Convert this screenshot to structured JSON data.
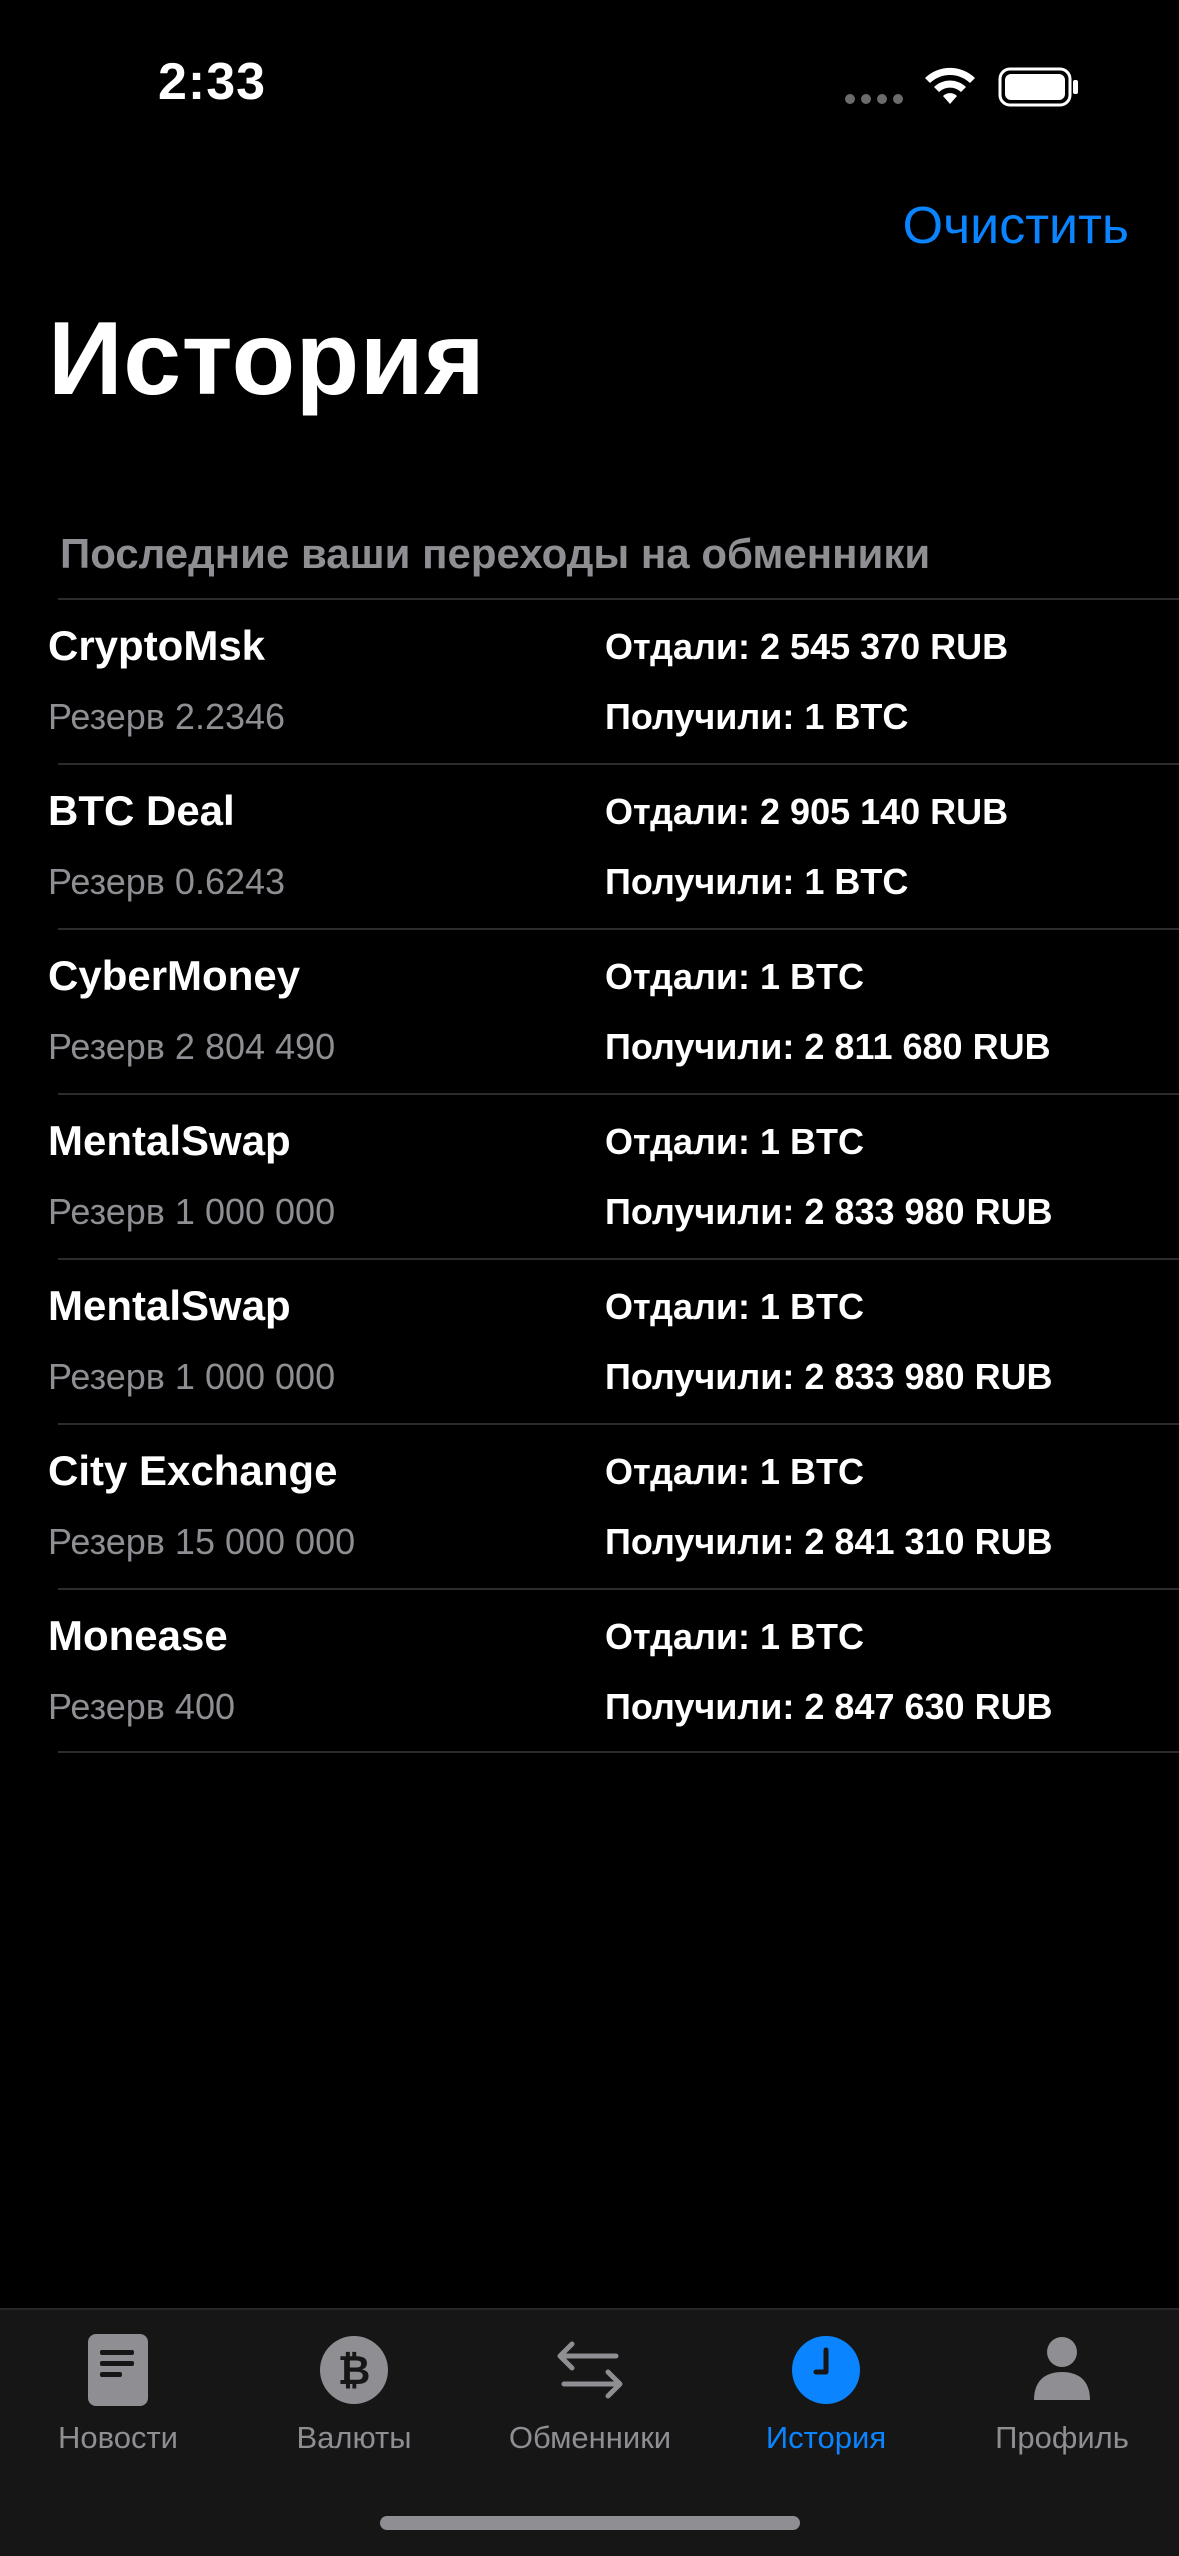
{
  "status_bar": {
    "time": "2:33"
  },
  "nav": {
    "clear_label": "Очистить",
    "title": "История"
  },
  "section": {
    "header": "Последние ваши переходы на обменники"
  },
  "history": [
    {
      "name": "CryptoMsk",
      "reserve": "Резерв 2.2346",
      "gave": "Отдали: 2 545 370 RUB",
      "received": "Получили: 1 BTC"
    },
    {
      "name": "BTC Deal",
      "reserve": "Резерв 0.6243",
      "gave": "Отдали: 2 905 140 RUB",
      "received": "Получили: 1 BTC"
    },
    {
      "name": "CyberMoney",
      "reserve": "Резерв 2 804 490",
      "gave": "Отдали: 1 BTC",
      "received": "Получили: 2 811 680 RUB"
    },
    {
      "name": "MentalSwap",
      "reserve": "Резерв 1 000 000",
      "gave": "Отдали: 1 BTC",
      "received": "Получили: 2 833 980 RUB"
    },
    {
      "name": "MentalSwap",
      "reserve": "Резерв 1 000 000",
      "gave": "Отдали: 1 BTC",
      "received": "Получили: 2 833 980 RUB"
    },
    {
      "name": "City Exchange",
      "reserve": "Резерв 15 000 000",
      "gave": "Отдали: 1 BTC",
      "received": "Получили: 2 841 310 RUB"
    },
    {
      "name": "Monease",
      "reserve": "Резерв 400",
      "gave": "Отдали: 1 BTC",
      "received": "Получили: 2 847 630 RUB"
    }
  ],
  "tabs": [
    {
      "label": "Новости",
      "icon": "news-icon"
    },
    {
      "label": "Валюты",
      "icon": "bitcoin-icon"
    },
    {
      "label": "Обменники",
      "icon": "exchange-arrows-icon"
    },
    {
      "label": "История",
      "icon": "clock-icon",
      "active": true
    },
    {
      "label": "Профиль",
      "icon": "profile-icon"
    }
  ],
  "colors": {
    "accent": "#0a84ff",
    "secondary_text": "#8e8e93",
    "background": "#000000",
    "tab_bar": "#161616"
  }
}
